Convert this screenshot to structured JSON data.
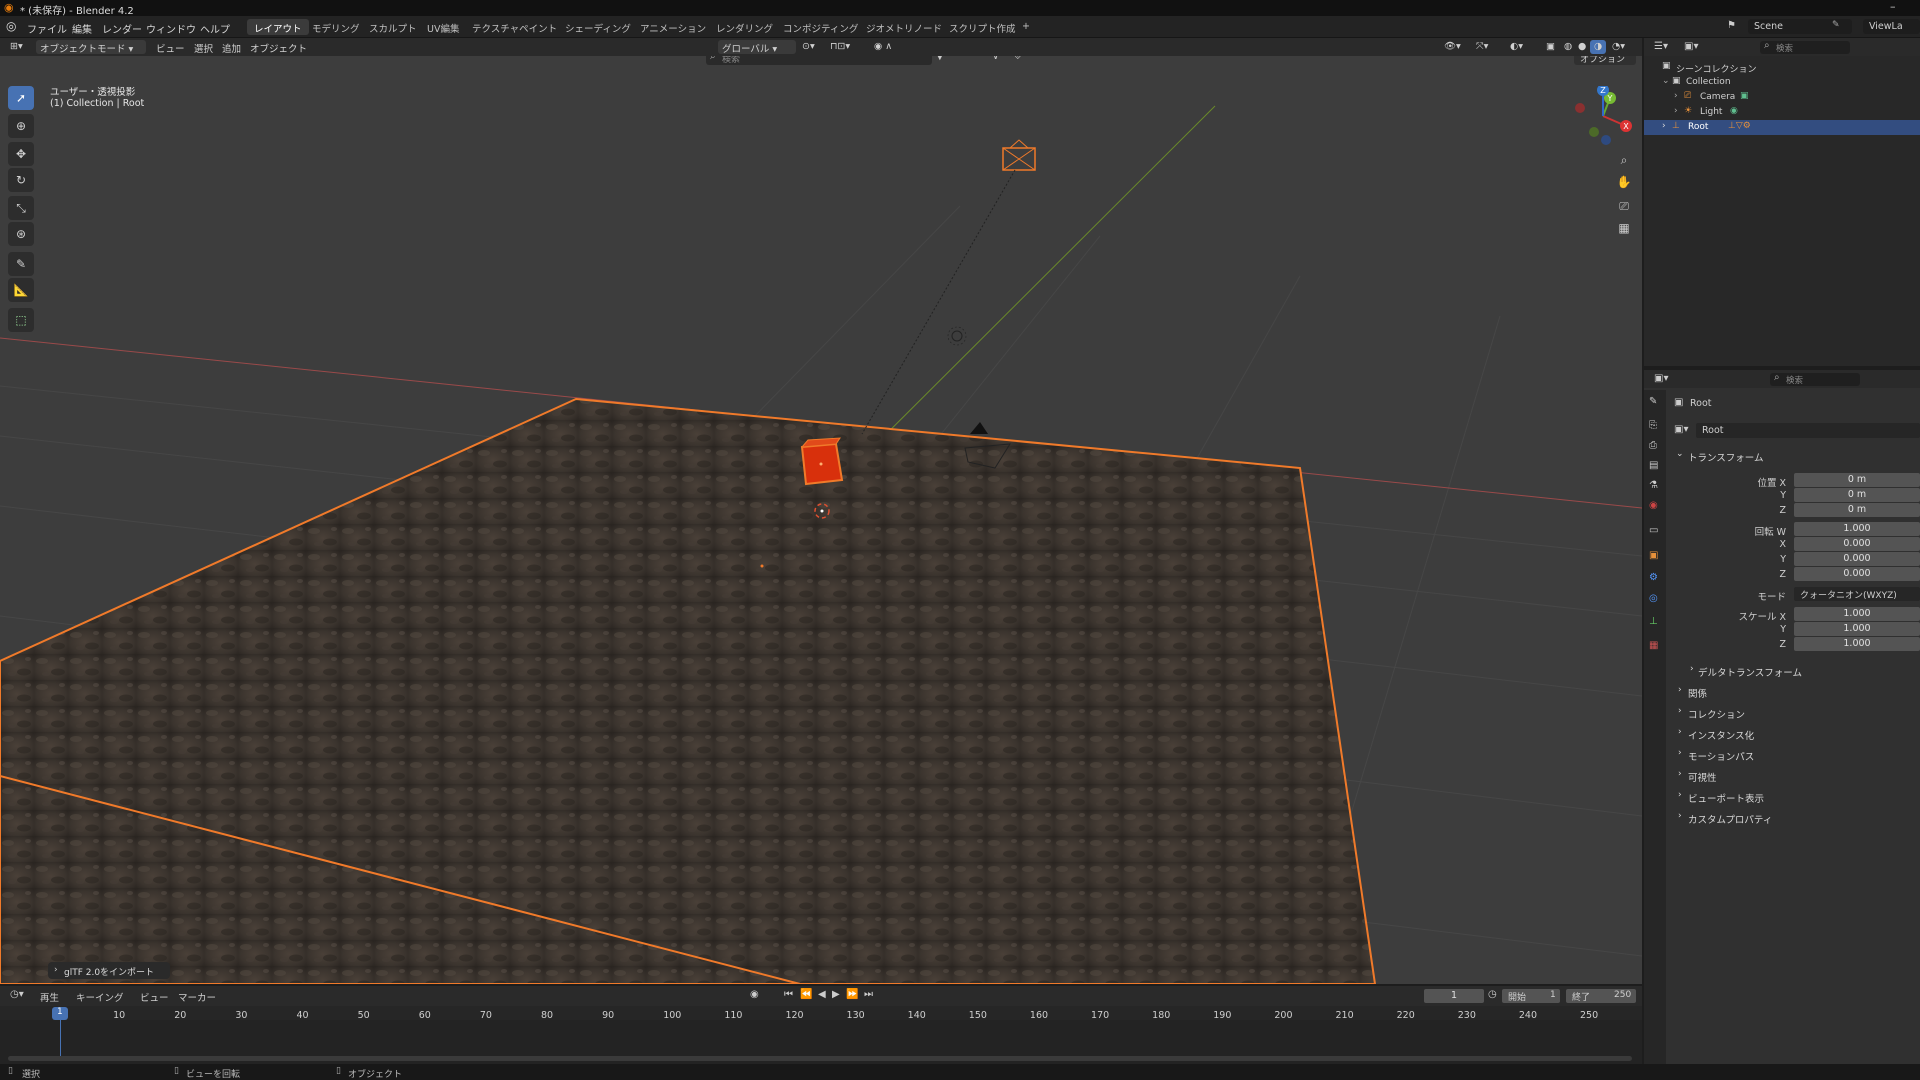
{
  "window": {
    "title": "* (未保存) - Blender 4.2"
  },
  "menu": {
    "items": [
      "ファイル",
      "編集",
      "レンダー",
      "ウィンドウ",
      "ヘルプ"
    ]
  },
  "workspaces": [
    "レイアウト",
    "モデリング",
    "スカルプト",
    "UV編集",
    "テクスチャペイント",
    "シェーディング",
    "アニメーション",
    "レンダリング",
    "コンポジティング",
    "ジオメトリノード",
    "スクリプト作成"
  ],
  "workspace_add": "+",
  "scene": {
    "name": "Scene",
    "viewlayer": "ViewLa"
  },
  "viewport": {
    "mode": "オブジェクトモード",
    "menus": [
      "ビュー",
      "選択",
      "追加",
      "オブジェクト"
    ],
    "transform_orientation": "グローバル",
    "search_placeholder": "検索",
    "options": "オプション",
    "info_line1": "ユーザー・透視投影",
    "info_line2": "(1) Collection | Root",
    "gizmo": {
      "x": "X",
      "y": "Y",
      "z": "Z"
    },
    "operator_panel": "glTF 2.0をインポート"
  },
  "outliner": {
    "search_placeholder": "検索",
    "root": "シーンコレクション",
    "collection": "Collection",
    "items": [
      "Camera",
      "Light",
      "Root"
    ]
  },
  "properties": {
    "search_placeholder": "検索",
    "object_name": "Root",
    "datablock_name": "Root",
    "transform_header": "トランスフォーム",
    "location_label": "位置 X",
    "location": [
      "0 m",
      "0 m",
      "0 m"
    ],
    "rotation_label": "回転 W",
    "rotation": [
      "1.000",
      "0.000",
      "0.000",
      "0.000"
    ],
    "mode_label": "モード",
    "mode_value": "クォータニオン(WXYZ)",
    "scale_label": "スケール X",
    "scale": [
      "1.000",
      "1.000",
      "1.000"
    ],
    "axis_labels": {
      "x": "X",
      "y": "Y",
      "z": "Z"
    },
    "delta": "デルタトランスフォーム",
    "sections": [
      "関係",
      "コレクション",
      "インスタンス化",
      "モーションパス",
      "可視性",
      "ビューポート表示",
      "カスタムプロパティ"
    ]
  },
  "timeline": {
    "menus": [
      "再生",
      "キーイング",
      "ビュー",
      "マーカー"
    ],
    "current_frame": "1",
    "start_label": "開始",
    "start": "1",
    "end_label": "終了",
    "end": "250",
    "frame_numbers": [
      "10",
      "20",
      "30",
      "40",
      "50",
      "60",
      "70",
      "80",
      "90",
      "100",
      "110",
      "120",
      "130",
      "140",
      "150",
      "160",
      "170",
      "180",
      "190",
      "200",
      "210",
      "220",
      "230",
      "240",
      "250"
    ]
  },
  "status": {
    "items": [
      "選択",
      "ビューを回転",
      "オブジェクト"
    ]
  },
  "colors": {
    "accent": "#4772b3",
    "selection": "#f07a2a",
    "highlight_row": "#334d80"
  }
}
